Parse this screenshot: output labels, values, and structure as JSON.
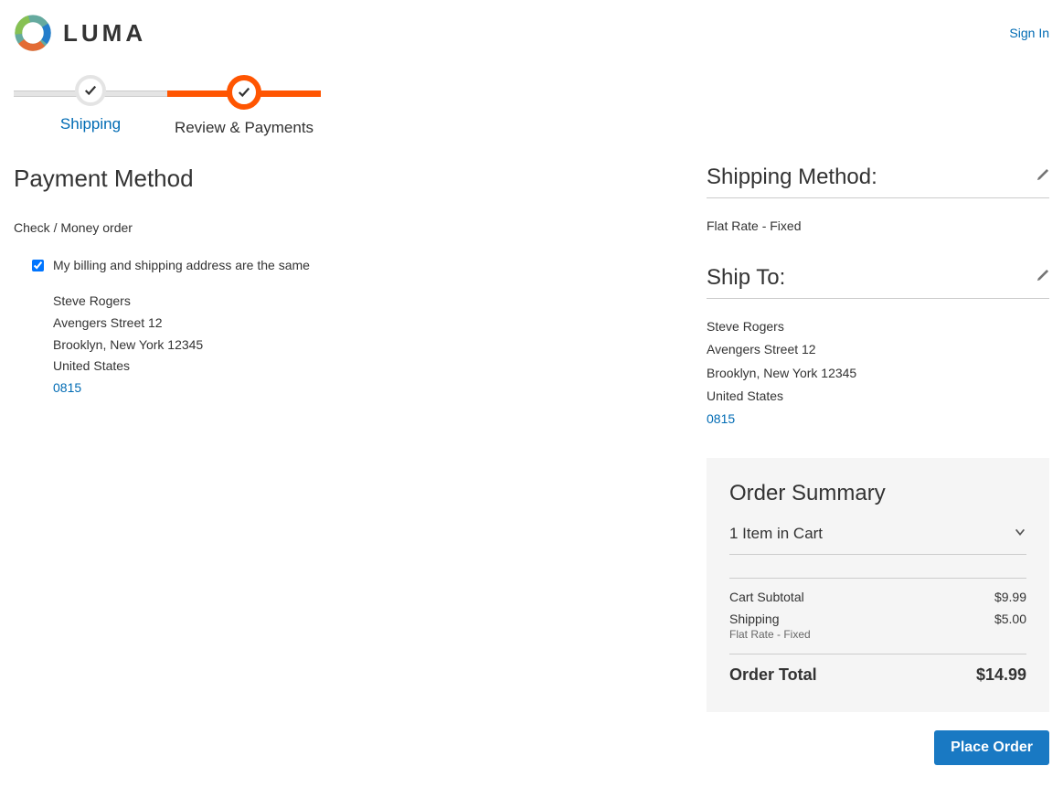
{
  "header": {
    "brand": "LUMA",
    "signin": "Sign In"
  },
  "progress": {
    "step1": "Shipping",
    "step2": "Review & Payments"
  },
  "payment": {
    "title": "Payment Method",
    "method": "Check / Money order",
    "same_address_label": "My billing and shipping address are the same",
    "address": {
      "name": "Steve Rogers",
      "street": "Avengers Street 12",
      "city_line": "Brooklyn, New York 12345",
      "country": "United States",
      "phone": "0815"
    }
  },
  "shipping_method": {
    "title": "Shipping Method:",
    "value": "Flat Rate - Fixed"
  },
  "ship_to": {
    "title": "Ship To:",
    "name": "Steve Rogers",
    "street": "Avengers Street 12",
    "city_line": "Brooklyn, New York 12345",
    "country": "United States",
    "phone": "0815"
  },
  "summary": {
    "title": "Order Summary",
    "items_line": "1 Item in Cart",
    "subtotal_label": "Cart Subtotal",
    "subtotal_value": "$9.99",
    "shipping_label": "Shipping",
    "shipping_sub": "Flat Rate - Fixed",
    "shipping_value": "$5.00",
    "total_label": "Order Total",
    "total_value": "$14.99",
    "place_order": "Place Order"
  }
}
